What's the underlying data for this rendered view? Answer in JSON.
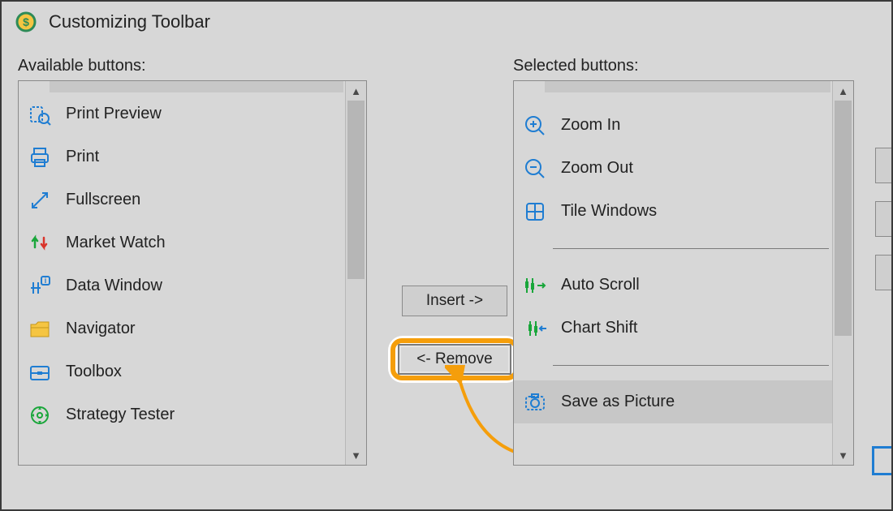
{
  "window": {
    "title": "Customizing Toolbar"
  },
  "labels": {
    "available": "Available buttons:",
    "selected": "Selected buttons:"
  },
  "buttons": {
    "insert": "Insert ->",
    "remove": "<- Remove"
  },
  "available": [
    {
      "icon": "print-preview-icon",
      "label": "Print Preview"
    },
    {
      "icon": "print-icon",
      "label": "Print"
    },
    {
      "icon": "fullscreen-icon",
      "label": "Fullscreen"
    },
    {
      "icon": "market-watch-icon",
      "label": "Market Watch"
    },
    {
      "icon": "data-window-icon",
      "label": "Data Window"
    },
    {
      "icon": "navigator-icon",
      "label": "Navigator"
    },
    {
      "icon": "toolbox-icon",
      "label": "Toolbox"
    },
    {
      "icon": "strategy-tester-icon",
      "label": "Strategy Tester"
    }
  ],
  "selected": [
    {
      "icon": "zoom-in-icon",
      "label": "Zoom In"
    },
    {
      "icon": "zoom-out-icon",
      "label": "Zoom Out"
    },
    {
      "icon": "tile-windows-icon",
      "label": "Tile Windows"
    },
    {
      "type": "separator"
    },
    {
      "icon": "auto-scroll-icon",
      "label": "Auto Scroll"
    },
    {
      "icon": "chart-shift-icon",
      "label": "Chart Shift"
    },
    {
      "type": "separator"
    },
    {
      "icon": "save-picture-icon",
      "label": "Save as Picture",
      "selected": true
    }
  ]
}
